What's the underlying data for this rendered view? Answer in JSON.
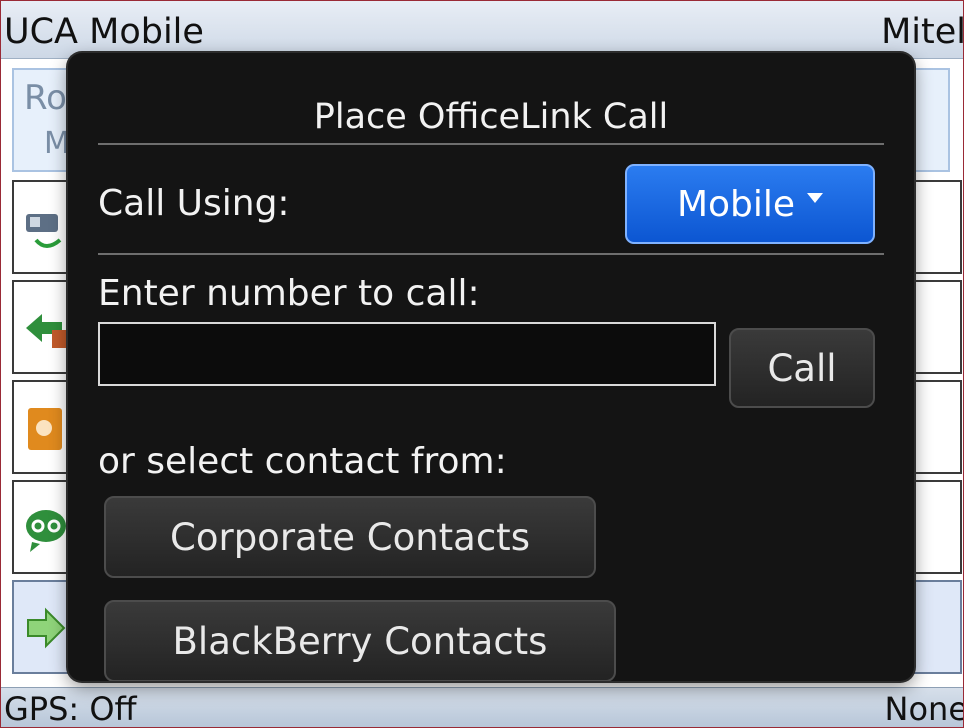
{
  "titlebar": {
    "app_name": "UCA Mobile",
    "right_text": "Mitel"
  },
  "background": {
    "banner_line1": "Ro",
    "banner_line2": "M"
  },
  "statusbar": {
    "gps": "GPS: Off",
    "right_text": "None"
  },
  "dialog": {
    "title": "Place OfficeLink Call",
    "call_using_label": "Call Using:",
    "call_using_value": "Mobile",
    "enter_number_label": "Enter number to call:",
    "number_value": "",
    "call_button": "Call",
    "select_contact_label": "or select contact from:",
    "corporate_contacts_button": "Corporate Contacts",
    "blackberry_contacts_button": "BlackBerry Contacts"
  },
  "colors": {
    "dialog_bg": "#141414",
    "dropdown_blue": "#1a66e0",
    "selected_row": "#dfe8f8",
    "frame_border": "#9a2a36"
  }
}
